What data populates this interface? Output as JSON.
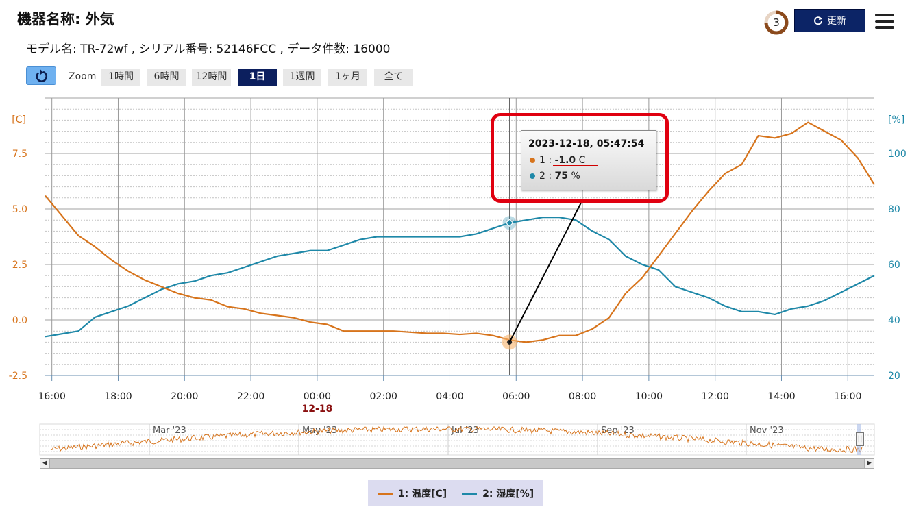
{
  "header": {
    "title": "機器名称: 外気",
    "subtitle": "モデル名: TR-72wf , シリアル番号: 52146FCC , データ件数: 16000",
    "counter": "3",
    "update_label": "更新"
  },
  "zoom": {
    "label": "Zoom",
    "buttons": [
      "1時間",
      "6時間",
      "12時間",
      "1日",
      "1週間",
      "1ヶ月",
      "全て"
    ],
    "active": "1日"
  },
  "colors": {
    "temperature": "#d7741c",
    "humidity": "#1e88a8",
    "highlight": "#e00010"
  },
  "tooltip": {
    "date": "2023-12-18, 05:47:54",
    "series1_label": "1 : ",
    "series1_value": "-1.0",
    "series1_unit": " C",
    "series2_label": "2 : ",
    "series2_value": "75",
    "series2_unit": " %"
  },
  "legend": {
    "series1": "1: 温度[C]",
    "series2": "2: 湿度[%]"
  },
  "navigator": {
    "months": [
      "Mar '23",
      "May '23",
      "Jul '23",
      "Sep '23",
      "Nov '23"
    ]
  },
  "chart_data": {
    "type": "line",
    "left_axis_label": "[C]",
    "right_axis_label": "[%]",
    "left_ylim": [
      -2.5,
      10
    ],
    "right_ylim": [
      20,
      120
    ],
    "left_ticks": [
      "7.5",
      "5.0",
      "2.5",
      "0.0",
      "-2.5"
    ],
    "right_ticks": [
      "100",
      "80",
      "60",
      "40",
      "20"
    ],
    "x_ticks": [
      "16:00",
      "18:00",
      "20:00",
      "22:00",
      "00:00",
      "02:00",
      "04:00",
      "06:00",
      "08:00",
      "10:00",
      "12:00",
      "14:00",
      "16:00"
    ],
    "x_date_marker": {
      "tick": "00:00",
      "label": "12-18"
    },
    "x_hours_range": [
      -8.2,
      16.8
    ],
    "series": [
      {
        "name": "1: 温度[C]",
        "axis": "left",
        "x": [
          -8.2,
          -7.7,
          -7.2,
          -6.7,
          -6.2,
          -5.7,
          -5.2,
          -4.7,
          -4.2,
          -3.7,
          -3.2,
          -2.7,
          -2.2,
          -1.7,
          -1.2,
          -0.7,
          -0.2,
          0.3,
          0.8,
          1.3,
          1.8,
          2.3,
          2.8,
          3.3,
          3.8,
          4.3,
          4.8,
          5.3,
          5.8,
          6.3,
          6.8,
          7.3,
          7.8,
          8.3,
          8.8,
          9.3,
          9.8,
          10.3,
          10.8,
          11.3,
          11.8,
          12.3,
          12.8,
          13.3,
          13.8,
          14.3,
          14.8,
          15.3,
          15.8,
          16.3,
          16.8
        ],
        "values": [
          5.6,
          4.7,
          3.8,
          3.3,
          2.7,
          2.2,
          1.8,
          1.5,
          1.2,
          1.0,
          0.9,
          0.6,
          0.5,
          0.3,
          0.2,
          0.1,
          -0.1,
          -0.2,
          -0.5,
          -0.5,
          -0.5,
          -0.5,
          -0.55,
          -0.6,
          -0.6,
          -0.65,
          -0.6,
          -0.7,
          -0.9,
          -1.0,
          -0.9,
          -0.7,
          -0.7,
          -0.4,
          0.1,
          1.2,
          1.9,
          2.9,
          3.9,
          4.9,
          5.8,
          6.6,
          7.0,
          8.3,
          8.2,
          8.4,
          8.9,
          8.5,
          8.1,
          7.3,
          6.1
        ]
      },
      {
        "name": "2: 湿度[%]",
        "axis": "right",
        "x": [
          -8.2,
          -7.7,
          -7.2,
          -6.7,
          -6.2,
          -5.7,
          -5.2,
          -4.7,
          -4.2,
          -3.7,
          -3.2,
          -2.7,
          -2.2,
          -1.7,
          -1.2,
          -0.7,
          -0.2,
          0.3,
          0.8,
          1.3,
          1.8,
          2.3,
          2.8,
          3.3,
          3.8,
          4.3,
          4.8,
          5.3,
          5.8,
          6.3,
          6.8,
          7.3,
          7.8,
          8.3,
          8.8,
          9.3,
          9.8,
          10.3,
          10.8,
          11.3,
          11.8,
          12.3,
          12.8,
          13.3,
          13.8,
          14.3,
          14.8,
          15.3,
          15.8,
          16.3,
          16.8
        ],
        "values": [
          34,
          35,
          36,
          41,
          43,
          45,
          48,
          51,
          53,
          54,
          56,
          57,
          59,
          61,
          63,
          64,
          65,
          65,
          67,
          69,
          70,
          70,
          70,
          70,
          70,
          70,
          71,
          73,
          75,
          76,
          77,
          77,
          76,
          72,
          69,
          63,
          60,
          58,
          52,
          50,
          48,
          45,
          43,
          43,
          42,
          44,
          45,
          47,
          50,
          53,
          56
        ]
      }
    ],
    "tooltip_point": {
      "x": 5.8,
      "temperature": -1.0,
      "humidity": 75
    }
  }
}
